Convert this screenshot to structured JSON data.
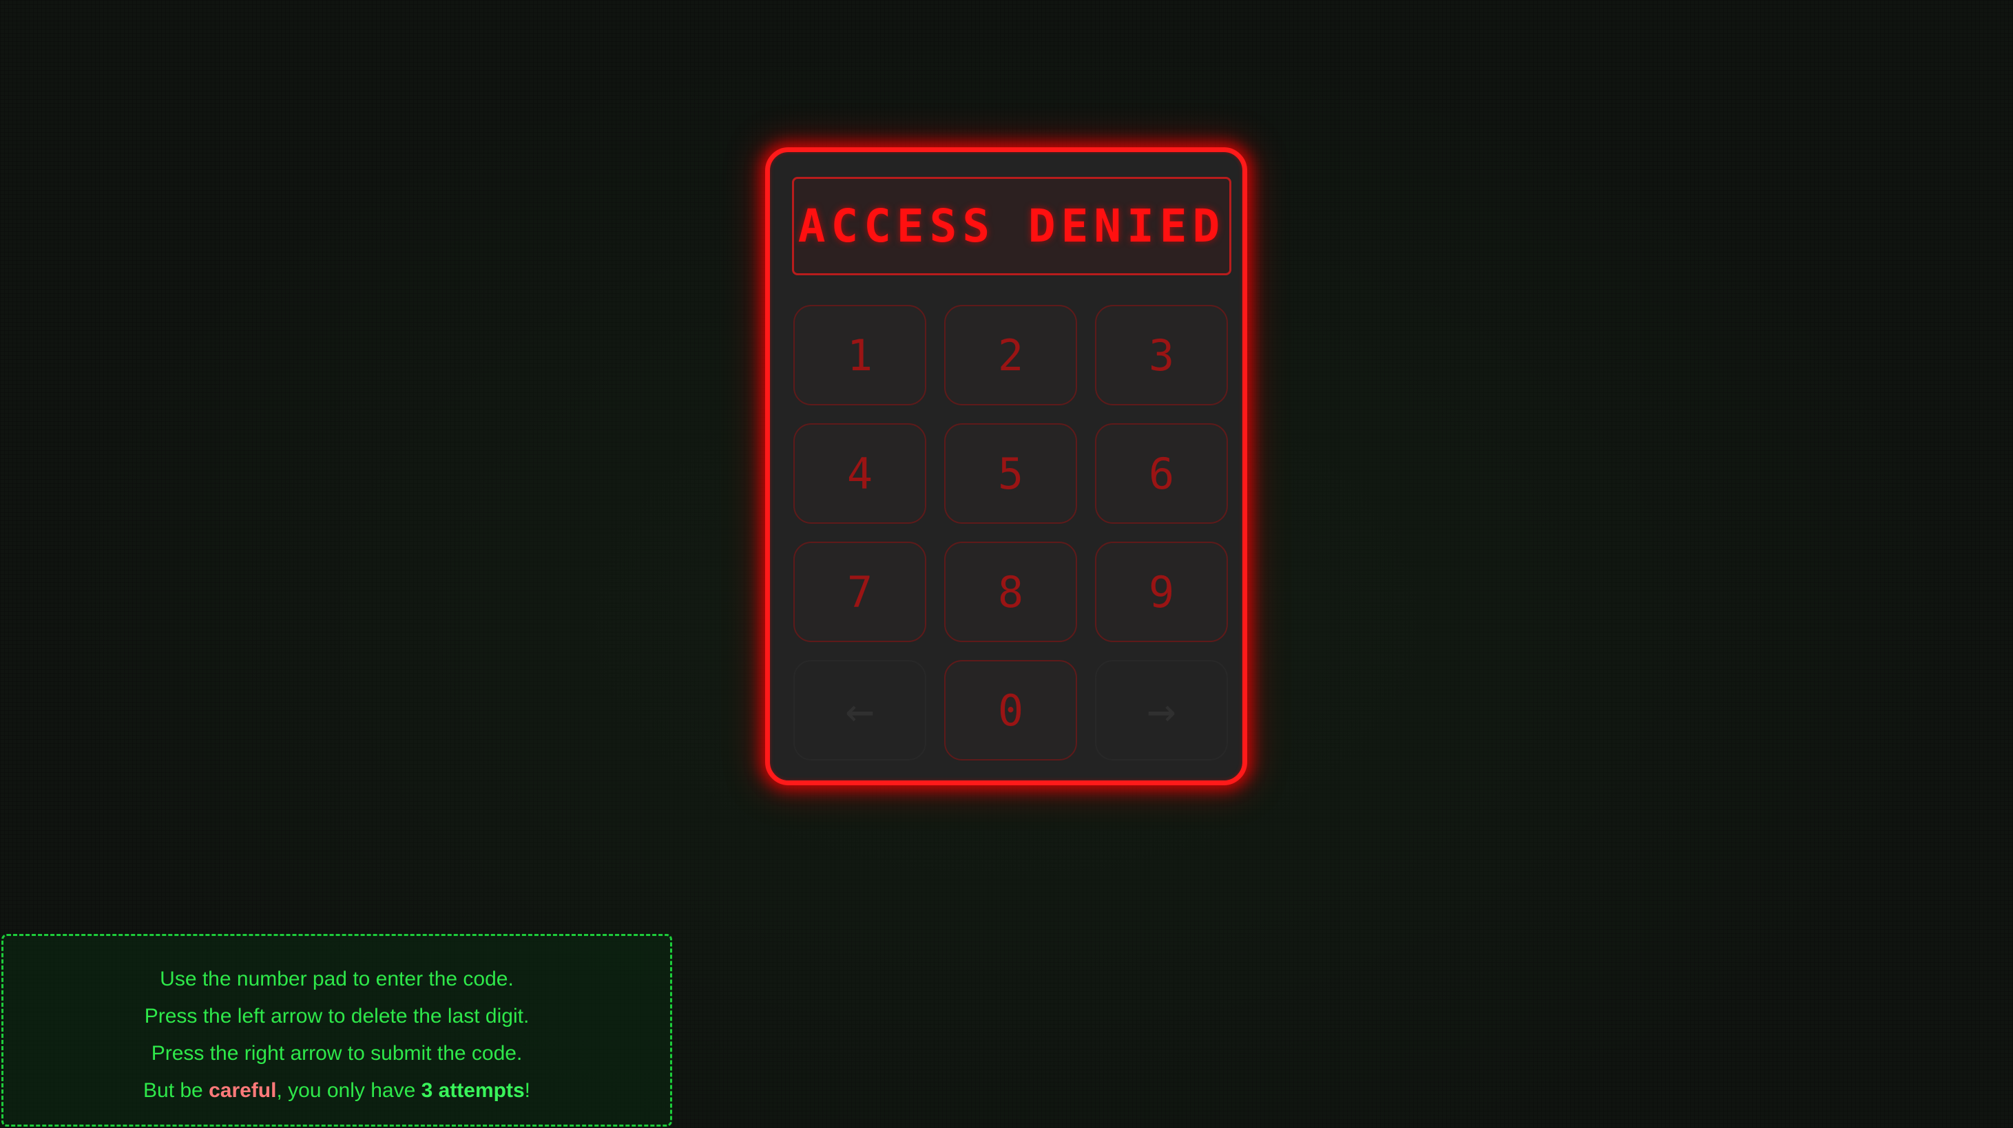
{
  "display": {
    "status": "ACCESS DENIED"
  },
  "keypad": {
    "keys": [
      "1",
      "2",
      "3",
      "4",
      "5",
      "6",
      "7",
      "8",
      "9"
    ],
    "zero": "0",
    "delete_icon": "←",
    "submit_icon": "→"
  },
  "instructions": {
    "line1": "Use the number pad to enter the code.",
    "line2": "Press the left arrow to delete the last digit.",
    "line3": "Press the right arrow to submit the code.",
    "line4_prefix": "But be ",
    "line4_careful": "careful",
    "line4_middle": ", you only have ",
    "line4_attempts": "3 attempts",
    "line4_suffix": "!"
  },
  "colors": {
    "accent_red": "#ff1a1a",
    "text_green": "#2ee84a",
    "background": "#101410"
  }
}
